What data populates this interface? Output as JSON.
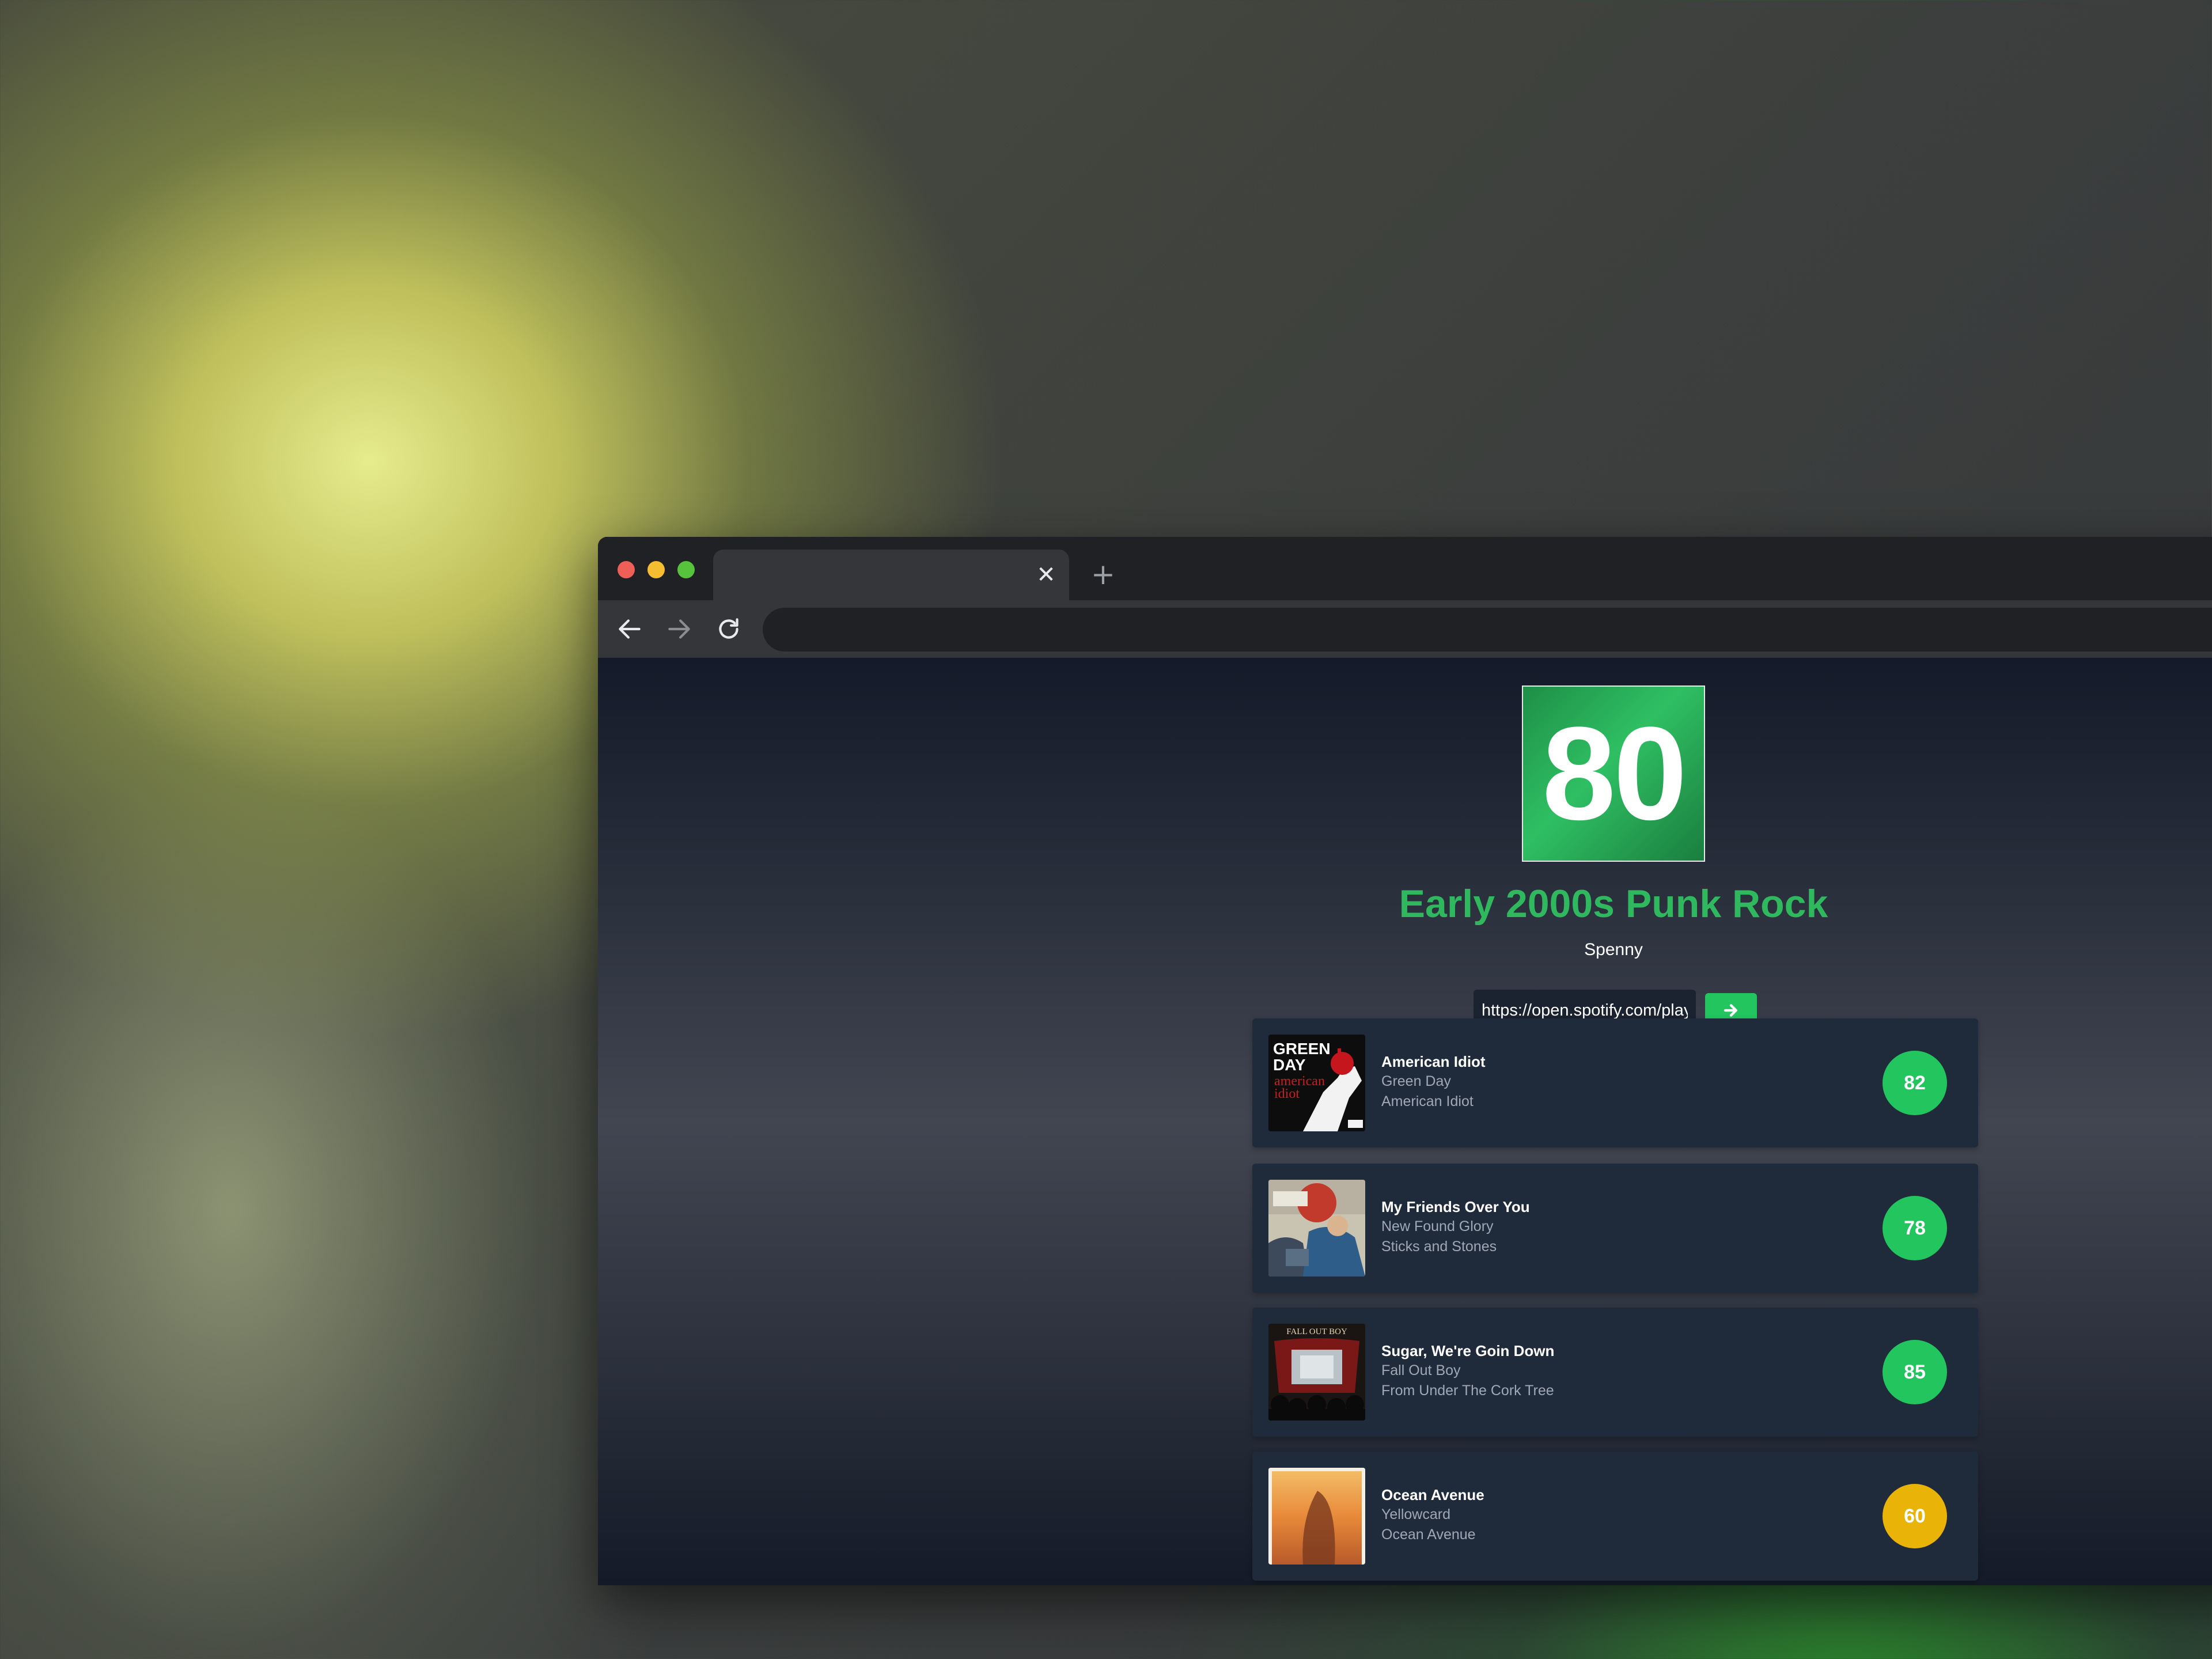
{
  "browser": {
    "tab_close_glyph": "✕",
    "new_tab_glyph": "+"
  },
  "playlist": {
    "score": "80",
    "title": "Early 2000s Punk Rock",
    "owner": "Spenny",
    "url_value": "https://open.spotify.com/playlist"
  },
  "colors": {
    "accent_green": "#22c55e",
    "score_yellow": "#eab308"
  },
  "tracks": [
    {
      "name": "American Idiot",
      "artist": "Green Day",
      "album": "American Idiot",
      "score": "82",
      "score_color": "#22c55e"
    },
    {
      "name": "My Friends Over You",
      "artist": "New Found Glory",
      "album": "Sticks and Stones",
      "score": "78",
      "score_color": "#22c55e"
    },
    {
      "name": "Sugar, We're Goin Down",
      "artist": "Fall Out Boy",
      "album": "From Under The Cork Tree",
      "score": "85",
      "score_color": "#22c55e"
    },
    {
      "name": "Ocean Avenue",
      "artist": "Yellowcard",
      "album": "Ocean Avenue",
      "score": "60",
      "score_color": "#eab308"
    }
  ],
  "covers": [
    {
      "lines": [
        "GREEN",
        "DAY",
        "american",
        "idiot"
      ]
    },
    {
      "lines": []
    },
    {
      "lines": [
        "FALL OUT BOY"
      ]
    },
    {
      "lines": []
    }
  ]
}
